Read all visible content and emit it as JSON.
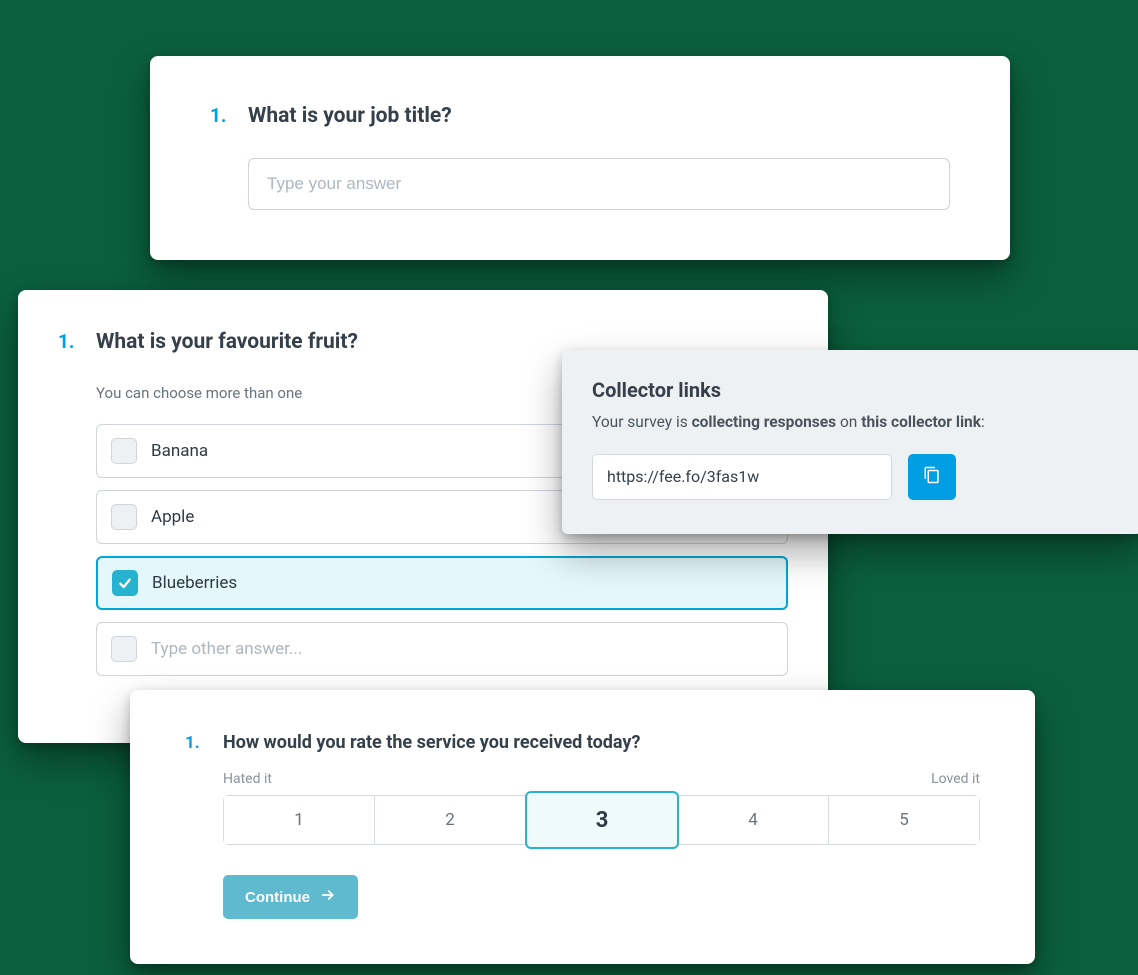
{
  "colors": {
    "accent": "#009fe3",
    "accent_light": "#27b3d0",
    "panel_bg": "#ffffff",
    "collector_bg": "#eef1f4",
    "text_primary": "#36404a",
    "text_muted": "#6a737c"
  },
  "q1": {
    "number": "1.",
    "text": "What is your job title?",
    "placeholder": "Type your answer"
  },
  "q2": {
    "number": "1.",
    "text": "What is your favourite fruit?",
    "hint": "You can choose more than one",
    "options": [
      {
        "label": "Banana",
        "selected": false
      },
      {
        "label": "Apple",
        "selected": false
      },
      {
        "label": "Blueberries",
        "selected": true
      }
    ],
    "other_placeholder": "Type other answer..."
  },
  "collector": {
    "title": "Collector links",
    "sub_prefix": "Your survey is ",
    "sub_strong1": "collecting responses",
    "sub_mid": " on ",
    "sub_strong2": "this collector link",
    "sub_suffix": ":",
    "url": "https://fee.fo/3fas1w",
    "copy_icon": "copy-icon"
  },
  "q3": {
    "number": "1.",
    "text": "How would you rate the service you received today?",
    "low_label": "Hated it",
    "high_label": "Loved it",
    "scale": [
      "1",
      "2",
      "3",
      "4",
      "5"
    ],
    "selected_index": 2,
    "continue_label": "Continue"
  }
}
